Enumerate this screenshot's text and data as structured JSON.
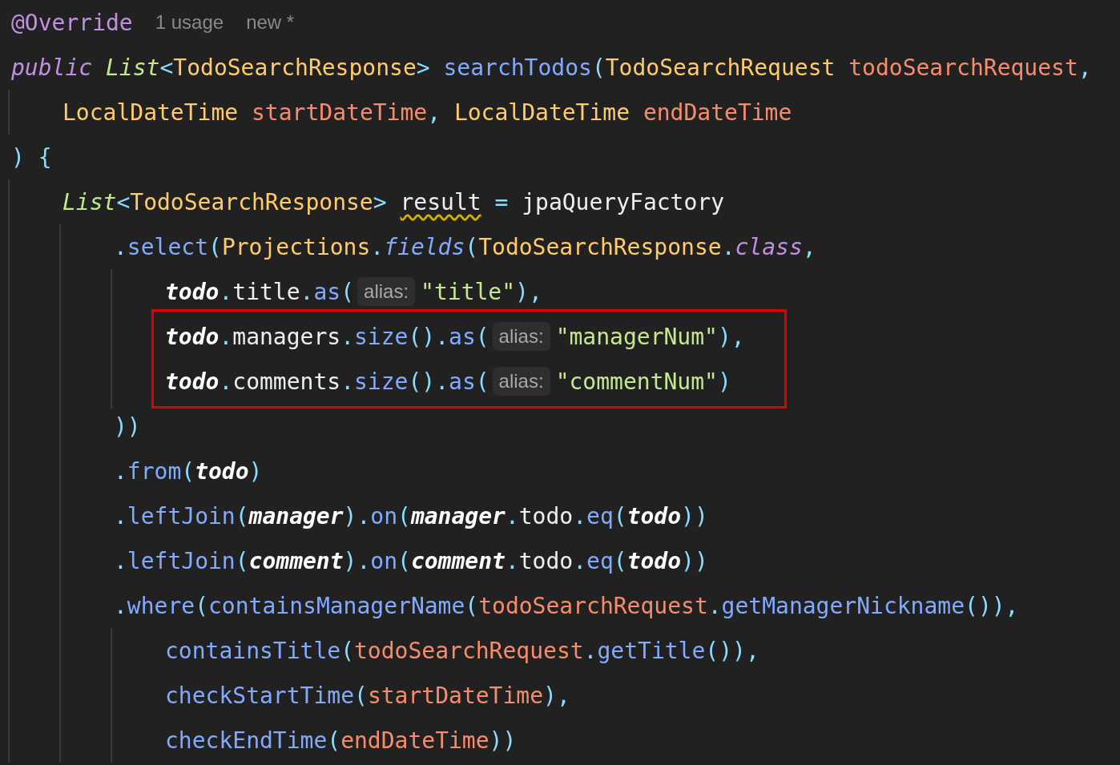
{
  "lines": [
    {
      "highlighted": false,
      "tokens": [
        {
          "text": "@Override",
          "kind": "anno"
        },
        {
          "text": "1 usage",
          "kind": "meta"
        },
        {
          "text": "new *",
          "kind": "meta"
        }
      ]
    },
    {
      "highlighted": false,
      "tokens": [
        {
          "text": "public ",
          "kind": "kw"
        },
        {
          "text": "List",
          "kind": "gen"
        },
        {
          "text": "<",
          "kind": "punc"
        },
        {
          "text": "TodoSearchResponse",
          "kind": "type"
        },
        {
          "text": "> ",
          "kind": "punc"
        },
        {
          "text": "searchTodos",
          "kind": "method"
        },
        {
          "text": "(",
          "kind": "punc"
        },
        {
          "text": "TodoSearchRequest ",
          "kind": "type"
        },
        {
          "text": "todoSearchRequest",
          "kind": "param"
        },
        {
          "text": ",",
          "kind": "punc"
        }
      ],
      "children": [
        {
          "highlighted": false,
          "tokens": [
            {
              "text": "LocalDateTime ",
              "kind": "type"
            },
            {
              "text": "startDateTime",
              "kind": "param"
            },
            {
              "text": ", ",
              "kind": "punc"
            },
            {
              "text": "LocalDateTime ",
              "kind": "type"
            },
            {
              "text": "endDateTime",
              "kind": "param"
            }
          ]
        }
      ]
    },
    {
      "highlighted": false,
      "tokens": [
        {
          "text": ") {",
          "kind": "punc"
        }
      ],
      "children": [
        {
          "highlighted": false,
          "tokens": [
            {
              "text": "List",
              "kind": "gen"
            },
            {
              "text": "<",
              "kind": "punc"
            },
            {
              "text": "TodoSearchResponse",
              "kind": "type"
            },
            {
              "text": "> ",
              "kind": "punc"
            },
            {
              "text": "result",
              "kind": "warn"
            },
            {
              "text": " = ",
              "kind": "punc"
            },
            {
              "text": "jpaQueryFactory",
              "kind": "plain"
            }
          ],
          "children": [
            {
              "highlighted": false,
              "tokens": [
                {
                  "text": ".",
                  "kind": "punc"
                },
                {
                  "text": "select",
                  "kind": "method"
                },
                {
                  "text": "(",
                  "kind": "punc"
                },
                {
                  "text": "Projections",
                  "kind": "type"
                },
                {
                  "text": ".",
                  "kind": "punc"
                },
                {
                  "text": "fields",
                  "kind": "mstatic"
                },
                {
                  "text": "(",
                  "kind": "punc"
                },
                {
                  "text": "TodoSearchResponse",
                  "kind": "type"
                },
                {
                  "text": ".",
                  "kind": "punc"
                },
                {
                  "text": "class",
                  "kind": "kw"
                },
                {
                  "text": ",",
                  "kind": "punc"
                }
              ],
              "children": [
                {
                  "highlighted": false,
                  "tokens": [
                    {
                      "text": "todo",
                      "kind": "static"
                    },
                    {
                      "text": ".",
                      "kind": "punc"
                    },
                    {
                      "text": "title",
                      "kind": "plain"
                    },
                    {
                      "text": ".",
                      "kind": "punc"
                    },
                    {
                      "text": "as",
                      "kind": "method"
                    },
                    {
                      "text": "(",
                      "kind": "punc"
                    },
                    {
                      "text": "alias:",
                      "kind": "hint"
                    },
                    {
                      "text": "\"title\"",
                      "kind": "str"
                    },
                    {
                      "text": "),",
                      "kind": "punc"
                    }
                  ]
                },
                {
                  "highlighted": true,
                  "tokens": [
                    {
                      "text": "todo",
                      "kind": "static"
                    },
                    {
                      "text": ".",
                      "kind": "punc"
                    },
                    {
                      "text": "managers",
                      "kind": "plain"
                    },
                    {
                      "text": ".",
                      "kind": "punc"
                    },
                    {
                      "text": "size",
                      "kind": "method"
                    },
                    {
                      "text": "().",
                      "kind": "punc"
                    },
                    {
                      "text": "as",
                      "kind": "method"
                    },
                    {
                      "text": "(",
                      "kind": "punc"
                    },
                    {
                      "text": "alias:",
                      "kind": "hint"
                    },
                    {
                      "text": "\"managerNum\"",
                      "kind": "str"
                    },
                    {
                      "text": "),",
                      "kind": "punc"
                    }
                  ]
                },
                {
                  "highlighted": true,
                  "tokens": [
                    {
                      "text": "todo",
                      "kind": "static"
                    },
                    {
                      "text": ".",
                      "kind": "punc"
                    },
                    {
                      "text": "comments",
                      "kind": "plain"
                    },
                    {
                      "text": ".",
                      "kind": "punc"
                    },
                    {
                      "text": "size",
                      "kind": "method"
                    },
                    {
                      "text": "().",
                      "kind": "punc"
                    },
                    {
                      "text": "as",
                      "kind": "method"
                    },
                    {
                      "text": "(",
                      "kind": "punc"
                    },
                    {
                      "text": "alias:",
                      "kind": "hint"
                    },
                    {
                      "text": "\"commentNum\"",
                      "kind": "str"
                    },
                    {
                      "text": ")",
                      "kind": "punc"
                    }
                  ]
                }
              ]
            },
            {
              "highlighted": false,
              "tokens": [
                {
                  "text": "))",
                  "kind": "punc"
                }
              ]
            },
            {
              "highlighted": false,
              "tokens": [
                {
                  "text": ".",
                  "kind": "punc"
                },
                {
                  "text": "from",
                  "kind": "method"
                },
                {
                  "text": "(",
                  "kind": "punc"
                },
                {
                  "text": "todo",
                  "kind": "static"
                },
                {
                  "text": ")",
                  "kind": "punc"
                }
              ]
            },
            {
              "highlighted": false,
              "tokens": [
                {
                  "text": ".",
                  "kind": "punc"
                },
                {
                  "text": "leftJoin",
                  "kind": "method"
                },
                {
                  "text": "(",
                  "kind": "punc"
                },
                {
                  "text": "manager",
                  "kind": "static"
                },
                {
                  "text": ").",
                  "kind": "punc"
                },
                {
                  "text": "on",
                  "kind": "method"
                },
                {
                  "text": "(",
                  "kind": "punc"
                },
                {
                  "text": "manager",
                  "kind": "static"
                },
                {
                  "text": ".",
                  "kind": "punc"
                },
                {
                  "text": "todo",
                  "kind": "plain"
                },
                {
                  "text": ".",
                  "kind": "punc"
                },
                {
                  "text": "eq",
                  "kind": "method"
                },
                {
                  "text": "(",
                  "kind": "punc"
                },
                {
                  "text": "todo",
                  "kind": "static"
                },
                {
                  "text": "))",
                  "kind": "punc"
                }
              ]
            },
            {
              "highlighted": false,
              "tokens": [
                {
                  "text": ".",
                  "kind": "punc"
                },
                {
                  "text": "leftJoin",
                  "kind": "method"
                },
                {
                  "text": "(",
                  "kind": "punc"
                },
                {
                  "text": "comment",
                  "kind": "static"
                },
                {
                  "text": ").",
                  "kind": "punc"
                },
                {
                  "text": "on",
                  "kind": "method"
                },
                {
                  "text": "(",
                  "kind": "punc"
                },
                {
                  "text": "comment",
                  "kind": "static"
                },
                {
                  "text": ".",
                  "kind": "punc"
                },
                {
                  "text": "todo",
                  "kind": "plain"
                },
                {
                  "text": ".",
                  "kind": "punc"
                },
                {
                  "text": "eq",
                  "kind": "method"
                },
                {
                  "text": "(",
                  "kind": "punc"
                },
                {
                  "text": "todo",
                  "kind": "static"
                },
                {
                  "text": "))",
                  "kind": "punc"
                }
              ]
            },
            {
              "highlighted": false,
              "tokens": [
                {
                  "text": ".",
                  "kind": "punc"
                },
                {
                  "text": "where",
                  "kind": "method"
                },
                {
                  "text": "(",
                  "kind": "punc"
                },
                {
                  "text": "containsManagerName",
                  "kind": "method"
                },
                {
                  "text": "(",
                  "kind": "punc"
                },
                {
                  "text": "todoSearchRequest",
                  "kind": "param"
                },
                {
                  "text": ".",
                  "kind": "punc"
                },
                {
                  "text": "getManagerNickname",
                  "kind": "method"
                },
                {
                  "text": "()),",
                  "kind": "punc"
                }
              ],
              "children": [
                {
                  "highlighted": false,
                  "tokens": [
                    {
                      "text": "containsTitle",
                      "kind": "method"
                    },
                    {
                      "text": "(",
                      "kind": "punc"
                    },
                    {
                      "text": "todoSearchRequest",
                      "kind": "param"
                    },
                    {
                      "text": ".",
                      "kind": "punc"
                    },
                    {
                      "text": "getTitle",
                      "kind": "method"
                    },
                    {
                      "text": "()),",
                      "kind": "punc"
                    }
                  ]
                },
                {
                  "highlighted": false,
                  "tokens": [
                    {
                      "text": "checkStartTime",
                      "kind": "method"
                    },
                    {
                      "text": "(",
                      "kind": "punc"
                    },
                    {
                      "text": "startDateTime",
                      "kind": "param"
                    },
                    {
                      "text": "),",
                      "kind": "punc"
                    }
                  ]
                },
                {
                  "highlighted": false,
                  "tokens": [
                    {
                      "text": "checkEndTime",
                      "kind": "method"
                    },
                    {
                      "text": "(",
                      "kind": "punc"
                    },
                    {
                      "text": "endDateTime",
                      "kind": "param"
                    },
                    {
                      "text": "))",
                      "kind": "punc"
                    }
                  ]
                }
              ]
            }
          ]
        }
      ]
    }
  ]
}
